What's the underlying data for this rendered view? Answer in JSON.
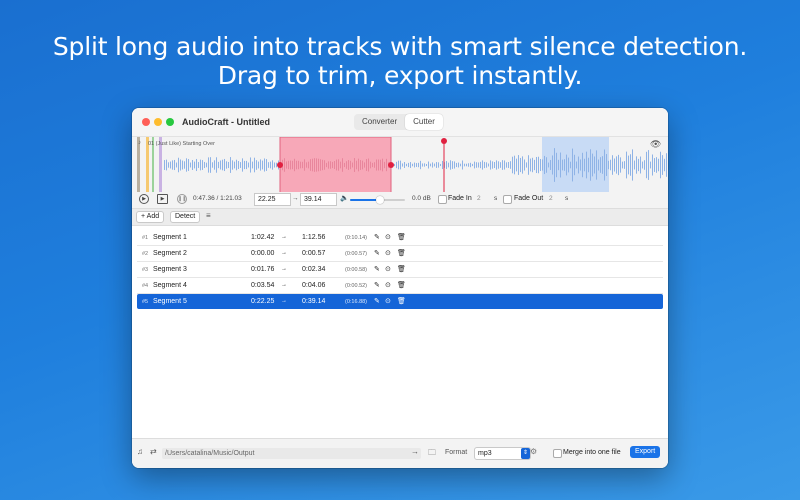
{
  "headline": {
    "line1": "Split long audio into tracks with smart silence detection.",
    "line2": "Drag to trim, export instantly."
  },
  "window": {
    "title": "AudioCraft - Untitled",
    "tabs": [
      {
        "label": "Converter",
        "active": false
      },
      {
        "label": "Cutter",
        "active": true
      }
    ]
  },
  "waveform": {
    "track_title": "01 (Just Like) Starting Over",
    "eye_icon": "eye-icon",
    "selection_color": "#f7a8b8",
    "highlight_color": "#c4d8f5"
  },
  "transport": {
    "time": "0:47.36 / 1:21.03",
    "start_value": "22.25",
    "arrow": "→",
    "end_value": "39.14",
    "volume_db": "0.0 dB",
    "volume_level": 0.55,
    "fade_in_label": "Fade In",
    "fade_in_value": "2",
    "fade_out_label": "Fade Out",
    "fade_out_value": "2",
    "unit": "s"
  },
  "toolbar": {
    "add_label": "+ Add",
    "detect_label": "Detect"
  },
  "segments": [
    {
      "num": "#1",
      "name": "Segment 1",
      "start": "1:02.42",
      "end": "1:12.56",
      "duration": "(0:10.14)",
      "selected": false
    },
    {
      "num": "#2",
      "name": "Segment 2",
      "start": "0:00.00",
      "end": "0:00.57",
      "duration": "(0:00.57)",
      "selected": false
    },
    {
      "num": "#3",
      "name": "Segment 3",
      "start": "0:01.76",
      "end": "0:02.34",
      "duration": "(0:00.58)",
      "selected": false
    },
    {
      "num": "#4",
      "name": "Segment 4",
      "start": "0:03.54",
      "end": "0:04.06",
      "duration": "(0:00.52)",
      "selected": false
    },
    {
      "num": "#5",
      "name": "Segment 5",
      "start": "0:22.25",
      "end": "0:39.14",
      "duration": "(0:16.88)",
      "selected": true
    }
  ],
  "bottom": {
    "output_path": "/Users/catalina/Music/Output",
    "format_label": "Format",
    "format_value": "mp3",
    "merge_label": "Merge into one file",
    "export_label": "Export"
  },
  "colors": {
    "accent": "#1565d8",
    "background": "#1f7fdd"
  }
}
